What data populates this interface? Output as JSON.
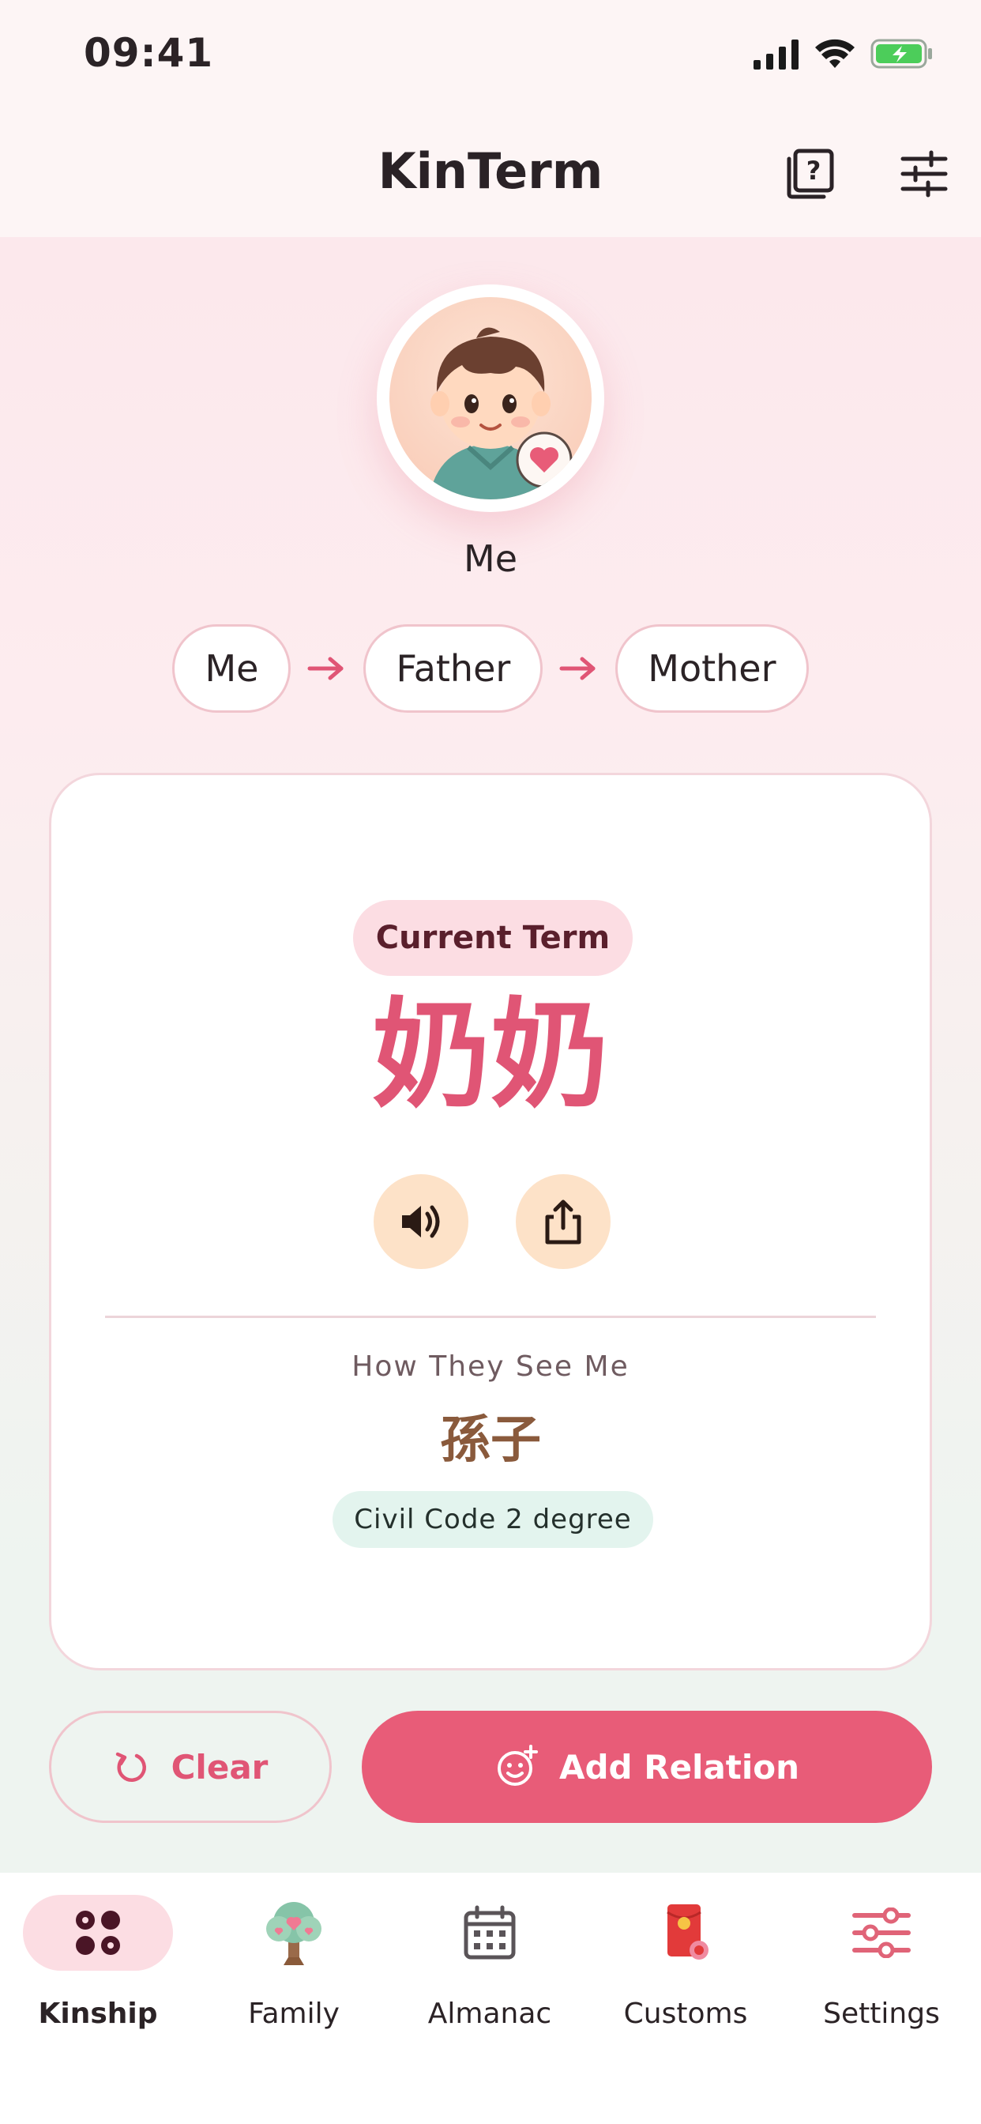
{
  "status_bar": {
    "time": "09:41",
    "icons": [
      "signal-icon",
      "wifi-icon",
      "battery-charging-icon"
    ]
  },
  "header": {
    "title": "KinTerm",
    "actions": [
      {
        "icon": "help-book-icon"
      },
      {
        "icon": "sliders-icon"
      }
    ]
  },
  "profile": {
    "avatar": "boy-avatar",
    "name": "Me"
  },
  "chain": [
    "Me",
    "Father",
    "Mother"
  ],
  "result": {
    "badge": "Current Term",
    "term": "奶奶",
    "reverse_label": "How They See Me",
    "reverse_term": "孫子",
    "degree": "Civil Code 2 degree",
    "actions": [
      {
        "icon": "speaker-icon"
      },
      {
        "icon": "share-icon"
      }
    ]
  },
  "buttons": {
    "clear": "Clear",
    "add": "Add Relation"
  },
  "tabs": [
    {
      "label": "Kinship",
      "icon": "kinship-grid-icon",
      "active": true
    },
    {
      "label": "Family",
      "icon": "family-tree-icon",
      "active": false
    },
    {
      "label": "Almanac",
      "icon": "calendar-icon",
      "active": false
    },
    {
      "label": "Customs",
      "icon": "red-envelope-icon",
      "active": false
    },
    {
      "label": "Settings",
      "icon": "settings-sliders-icon",
      "active": false
    }
  ],
  "colors": {
    "accent": "#e85c78",
    "accent_text": "#e05575",
    "badge_bg": "#fcdde3",
    "degree_bg": "#e3f4ee",
    "icon_circle": "#fde2c8"
  }
}
